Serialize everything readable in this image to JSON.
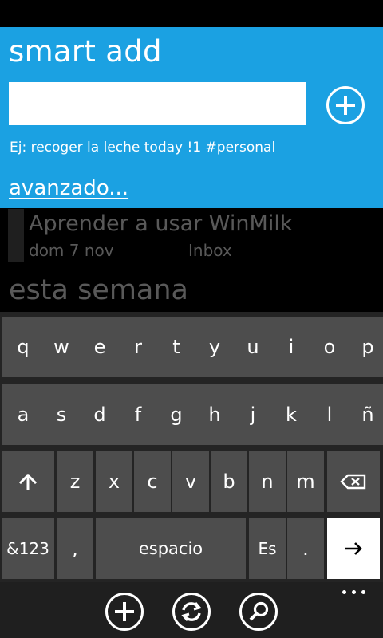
{
  "smart_add": {
    "title": "smart add",
    "input_value": "",
    "add_icon": "plus-circle-icon",
    "hint": "Ej: recoger la leche today !1 #personal",
    "advanced_link": "avanzado..."
  },
  "task": {
    "title": "Aprender a usar WinMilk",
    "date": "dom 7 nov",
    "list": "Inbox"
  },
  "section_header": "esta semana",
  "keyboard": {
    "row1": [
      "q",
      "w",
      "e",
      "r",
      "t",
      "y",
      "u",
      "i",
      "o",
      "p"
    ],
    "row2": [
      "a",
      "s",
      "d",
      "f",
      "g",
      "h",
      "j",
      "k",
      "l",
      "ñ"
    ],
    "row3": [
      "z",
      "x",
      "c",
      "v",
      "b",
      "n",
      "m"
    ],
    "shift_icon": "shift-arrow-icon",
    "backspace_icon": "backspace-icon",
    "symbols_label": "&123",
    "comma_label": ",",
    "space_label": "espacio",
    "language_label": "Es",
    "period_label": ".",
    "enter_icon": "enter-arrow-icon"
  },
  "app_bar": {
    "buttons": [
      "add-icon",
      "sync-icon",
      "search-icon"
    ],
    "more_icon": "ellipsis-icon"
  },
  "colors": {
    "accent": "#1ba1e2",
    "key": "#4d4d4d",
    "keyboard_bg": "#242424",
    "dimmed_text": "#595959"
  }
}
